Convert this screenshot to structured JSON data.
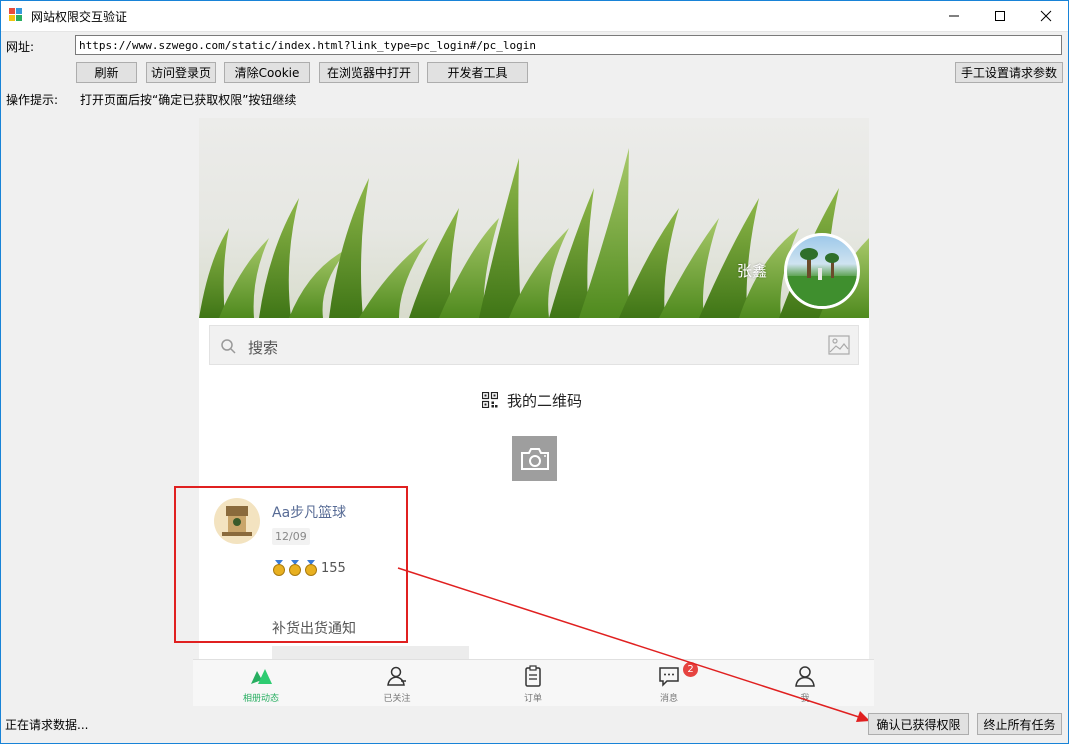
{
  "window": {
    "title": "网站权限交互验证",
    "controls": {
      "minimize": "–",
      "maximize": "☐",
      "close": "✕"
    }
  },
  "address": {
    "label": "网址:",
    "value": "https://www.szwego.com/static/index.html?link_type=pc_login#/pc_login"
  },
  "toolbar": {
    "refresh": "刷新",
    "visit_login": "访问登录页",
    "clear_cookie": "清除Cookie",
    "open_browser": "在浏览器中打开",
    "dev_tools": "开发者工具",
    "manual_params": "手工设置请求参数"
  },
  "hint": {
    "label": "操作提示:",
    "text": "打开页面后按“确定已获取权限”按钮继续"
  },
  "webpage": {
    "username": "张鑫",
    "search_placeholder": "搜索",
    "qr_label": "我的二维码",
    "post": {
      "name": "Aa步凡篮球",
      "date": "12/09",
      "medal_count": "155",
      "title": "补货出货通知"
    },
    "tabs": [
      {
        "label": "相册动态",
        "icon": "album-icon",
        "active": true
      },
      {
        "label": "已关注",
        "icon": "follow-icon",
        "active": false
      },
      {
        "label": "订单",
        "icon": "clipboard-icon",
        "active": false
      },
      {
        "label": "消息",
        "icon": "message-icon",
        "active": false,
        "badge": "2"
      },
      {
        "label": "我",
        "icon": "person-icon",
        "active": false
      }
    ],
    "accent_color": "#27ae60"
  },
  "status": {
    "text": "正在请求数据...",
    "confirm_button": "确认已获得权限",
    "stop_button": "终止所有任务"
  },
  "annotation": {
    "color": "#e02020"
  }
}
